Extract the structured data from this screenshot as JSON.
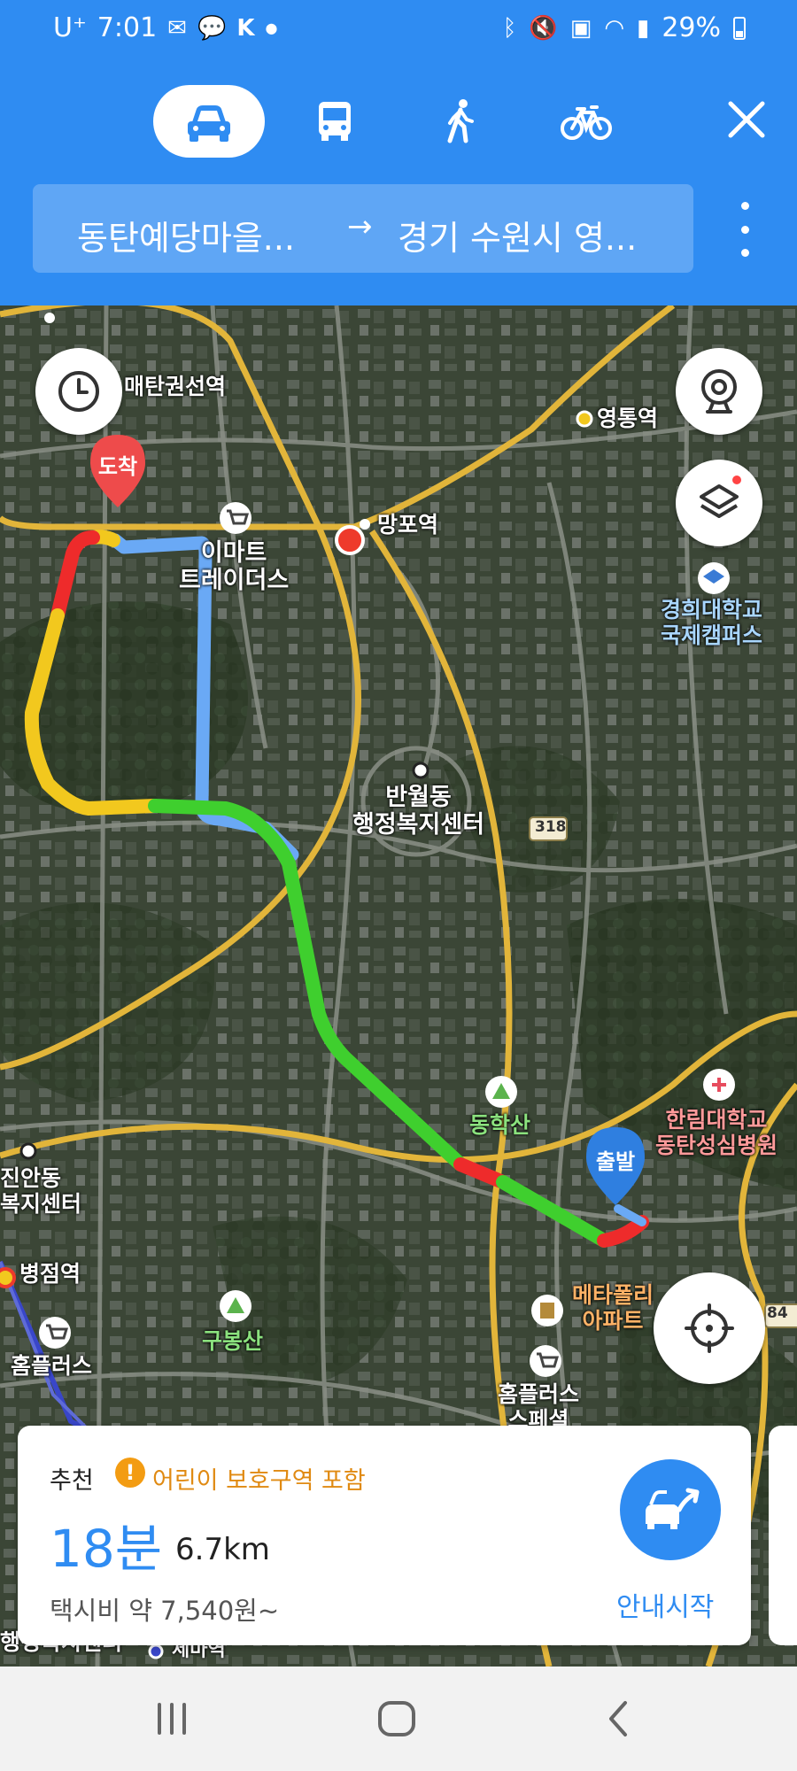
{
  "status_bar": {
    "carrier": "U⁺",
    "time": "7:01",
    "battery_percent": "29%",
    "left_icons": [
      "mail-icon",
      "talk-icon",
      "k-icon",
      "dot-icon"
    ],
    "right_icons": [
      "bluetooth-icon",
      "mute-icon",
      "sim-icon",
      "wifi-icon",
      "signal-icon",
      "battery-icon"
    ]
  },
  "transport_modes": [
    {
      "name": "car",
      "icon": "car-icon",
      "active": true
    },
    {
      "name": "bus",
      "icon": "bus-icon",
      "active": false
    },
    {
      "name": "walk",
      "icon": "walk-icon",
      "active": false
    },
    {
      "name": "bike",
      "icon": "bike-icon",
      "active": false
    }
  ],
  "route": {
    "from": "동탄예당마을...",
    "arrow": "→",
    "to": "경기 수원시 영..."
  },
  "map": {
    "labels": {
      "maetan": "매탄권선역",
      "yeongtong": "영통역",
      "mangpo": "망포역",
      "emart": "이마트\n트레이더스",
      "khu": "경희대학교\n국제캠퍼스",
      "banwol": "반월동\n행정복지센터",
      "road_318": "318",
      "donghaksan": "동학산",
      "hallym": "한림대학교\n동탄성심병원",
      "jinan": "진안동\n복지센터",
      "byeongjeom": "병점역",
      "gubongsan": "구봉산",
      "homeplus1": "홈플러스",
      "metapolis": "메타폴리\n아파트",
      "homeplus2": "홈플러스\n스페셜",
      "road_84": "84",
      "jemaeok": "세마역",
      "left_center": "행정복지센터"
    },
    "pins": {
      "destination": "도착",
      "origin": "출발"
    },
    "route_colors": {
      "smooth": "#3fcf2e",
      "slow": "#f2c81e",
      "jam": "#ee2b2b",
      "alt": "#6aa9f5"
    }
  },
  "summary_card": {
    "recommend_label": "추천",
    "warning_text": "어린이 보호구역 포함",
    "time": "18분",
    "distance": "6.7km",
    "fare": "택시비 약 7,540원~",
    "start_label": "안내시작"
  },
  "colors": {
    "brand": "#2f8cf2"
  }
}
